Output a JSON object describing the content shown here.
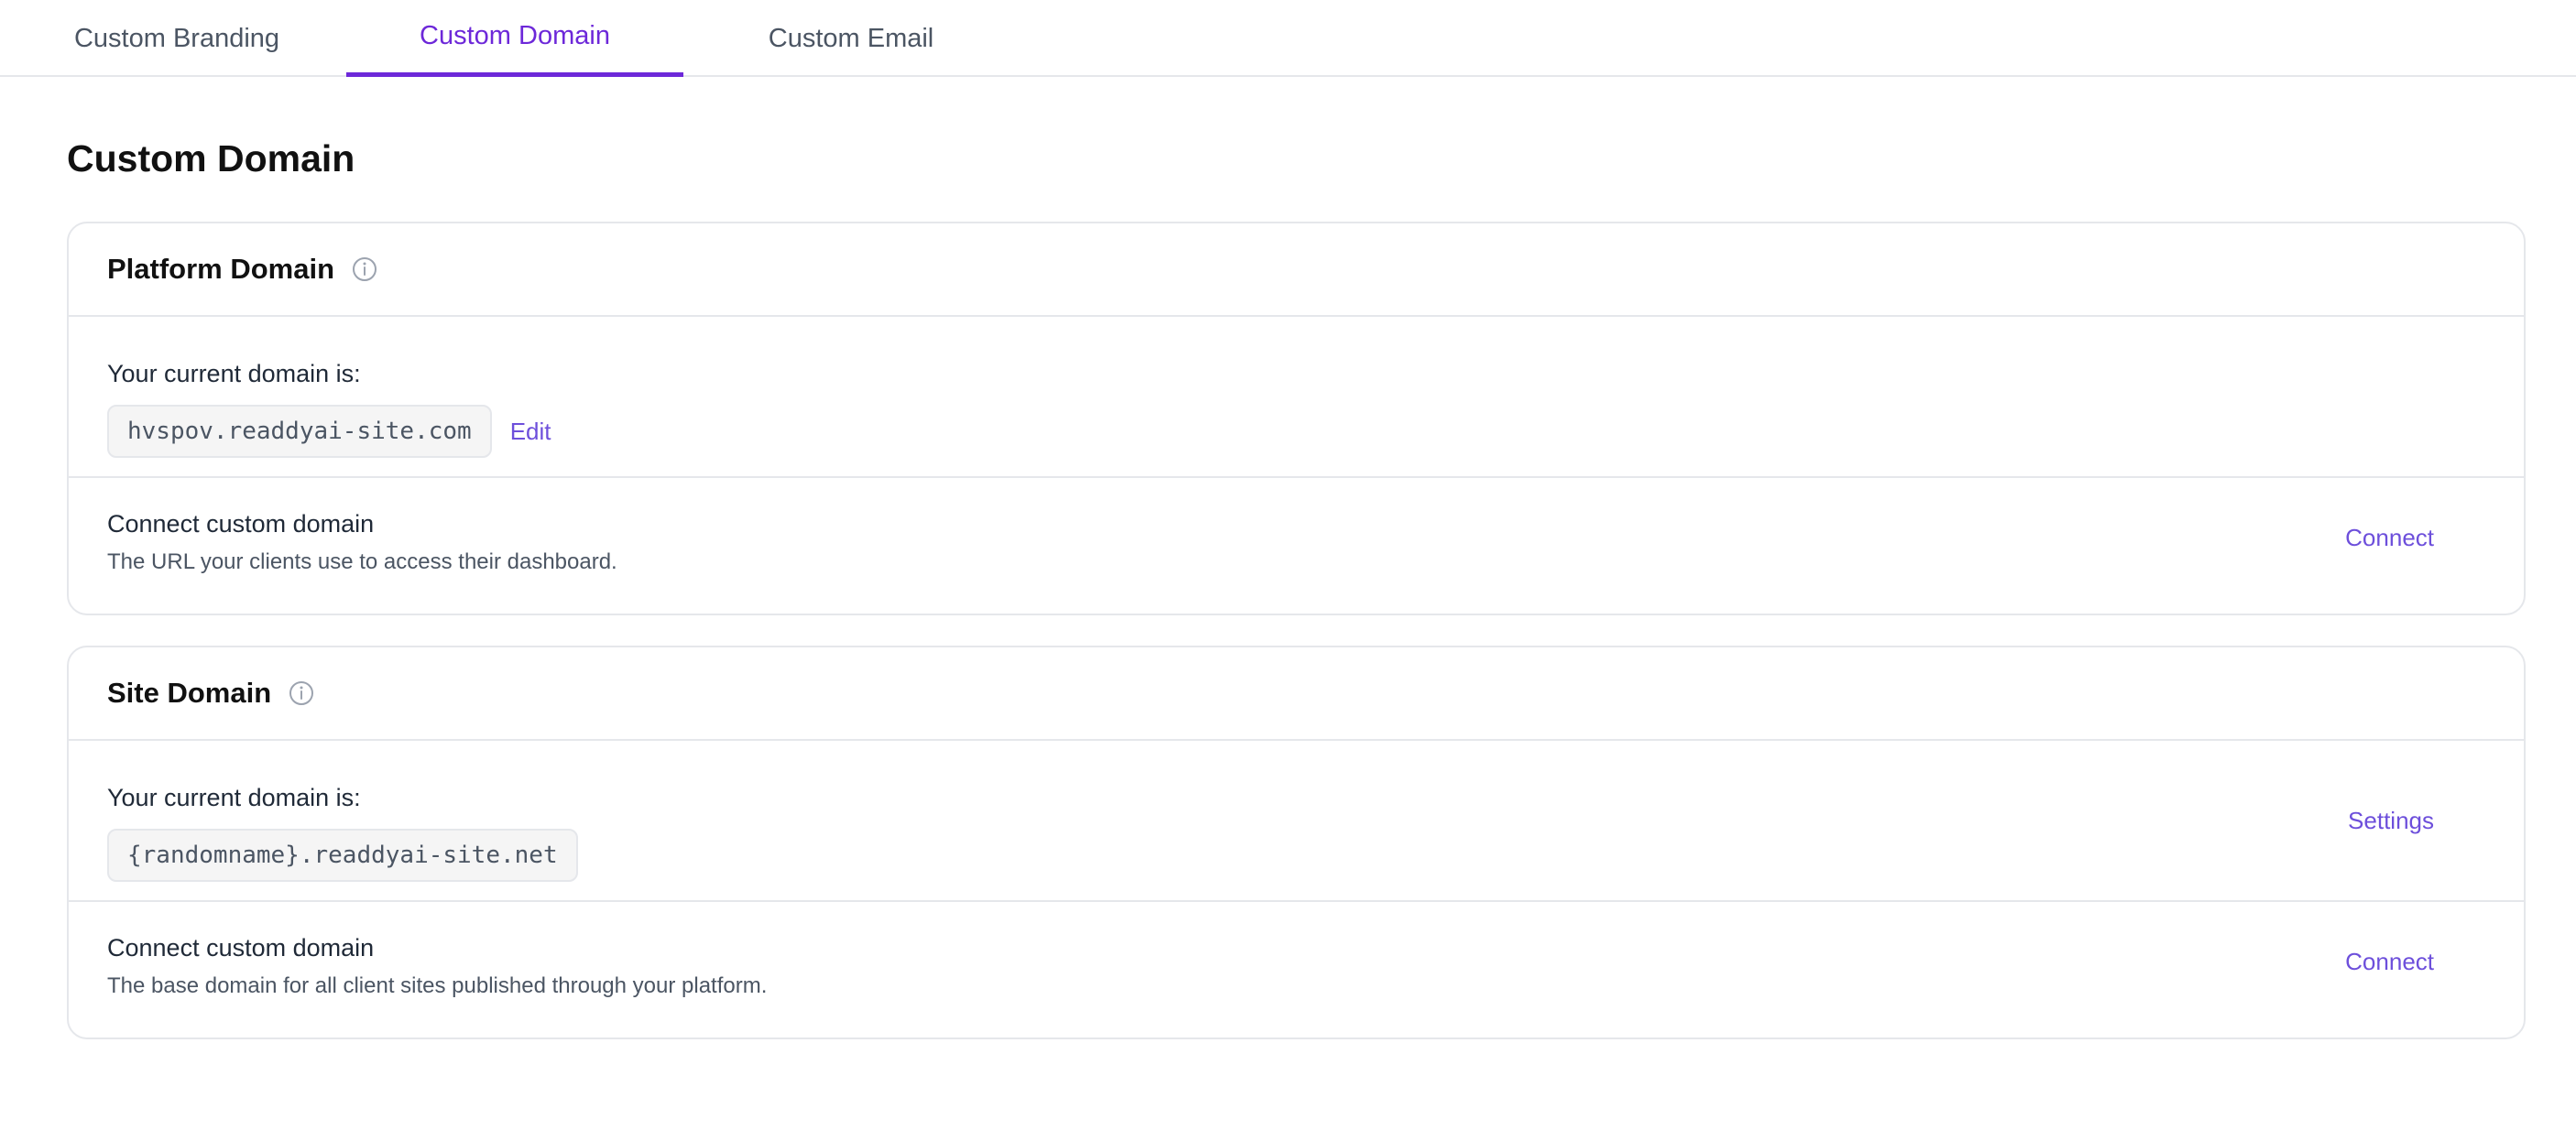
{
  "tabs": [
    {
      "label": "Custom Branding",
      "active": false
    },
    {
      "label": "Custom Domain",
      "active": true
    },
    {
      "label": "Custom Email",
      "active": false
    }
  ],
  "page_title": "Custom Domain",
  "colors": {
    "accent": "#6d28d9",
    "link": "#6d4fdb",
    "border": "#e5e7eb"
  },
  "platform": {
    "title": "Platform Domain",
    "info_icon": "info-icon",
    "current_label": "Your current domain is:",
    "current_domain": "hvspov.readdyai-site.com",
    "edit_label": "Edit",
    "connect_title": "Connect custom domain",
    "connect_desc": "The URL your clients use to access their dashboard.",
    "connect_label": "Connect"
  },
  "site": {
    "title": "Site Domain",
    "info_icon": "info-icon",
    "current_label": "Your current domain is:",
    "current_domain": "{randomname}.readdyai-site.net",
    "settings_label": "Settings",
    "connect_title": "Connect custom domain",
    "connect_desc": "The base domain for all client sites published through your platform.",
    "connect_label": "Connect"
  }
}
